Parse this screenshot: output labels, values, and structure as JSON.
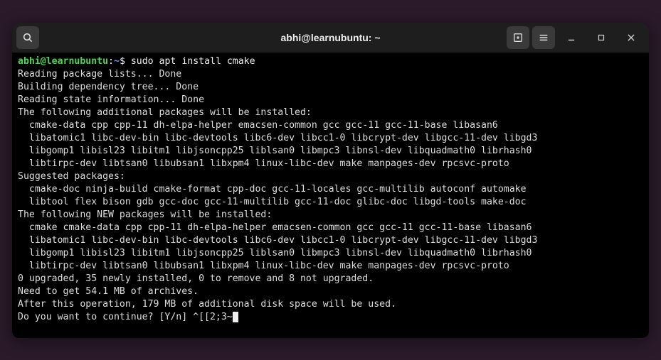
{
  "titlebar": {
    "title": "abhi@learnubuntu: ~"
  },
  "prompt": {
    "userhost": "abhi@learnubuntu",
    "colon": ":",
    "path": "~",
    "dollar": "$",
    "command": "sudo apt install cmake"
  },
  "output": {
    "l1": "Reading package lists... Done",
    "l2": "Building dependency tree... Done",
    "l3": "Reading state information... Done",
    "l4": "The following additional packages will be installed:",
    "l5": "  cmake-data cpp cpp-11 dh-elpa-helper emacsen-common gcc gcc-11 gcc-11-base libasan6",
    "l6": "  libatomic1 libc-dev-bin libc-devtools libc6-dev libcc1-0 libcrypt-dev libgcc-11-dev libgd3",
    "l7": "  libgomp1 libisl23 libitm1 libjsoncpp25 liblsan0 libmpc3 libnsl-dev libquadmath0 librhash0",
    "l8": "  libtirpc-dev libtsan0 libubsan1 libxpm4 linux-libc-dev make manpages-dev rpcsvc-proto",
    "l9": "Suggested packages:",
    "l10": "  cmake-doc ninja-build cmake-format cpp-doc gcc-11-locales gcc-multilib autoconf automake",
    "l11": "  libtool flex bison gdb gcc-doc gcc-11-multilib gcc-11-doc glibc-doc libgd-tools make-doc",
    "l12": "The following NEW packages will be installed:",
    "l13": "  cmake cmake-data cpp cpp-11 dh-elpa-helper emacsen-common gcc gcc-11 gcc-11-base libasan6",
    "l14": "  libatomic1 libc-dev-bin libc-devtools libc6-dev libcc1-0 libcrypt-dev libgcc-11-dev libgd3",
    "l15": "  libgomp1 libisl23 libitm1 libjsoncpp25 liblsan0 libmpc3 libnsl-dev libquadmath0 librhash0",
    "l16": "  libtirpc-dev libtsan0 libubsan1 libxpm4 linux-libc-dev make manpages-dev rpcsvc-proto",
    "l17": "0 upgraded, 35 newly installed, 0 to remove and 8 not upgraded.",
    "l18": "Need to get 54.1 MB of archives.",
    "l19": "After this operation, 179 MB of additional disk space will be used.",
    "l20": "Do you want to continue? [Y/n] ^[[2;3~"
  }
}
